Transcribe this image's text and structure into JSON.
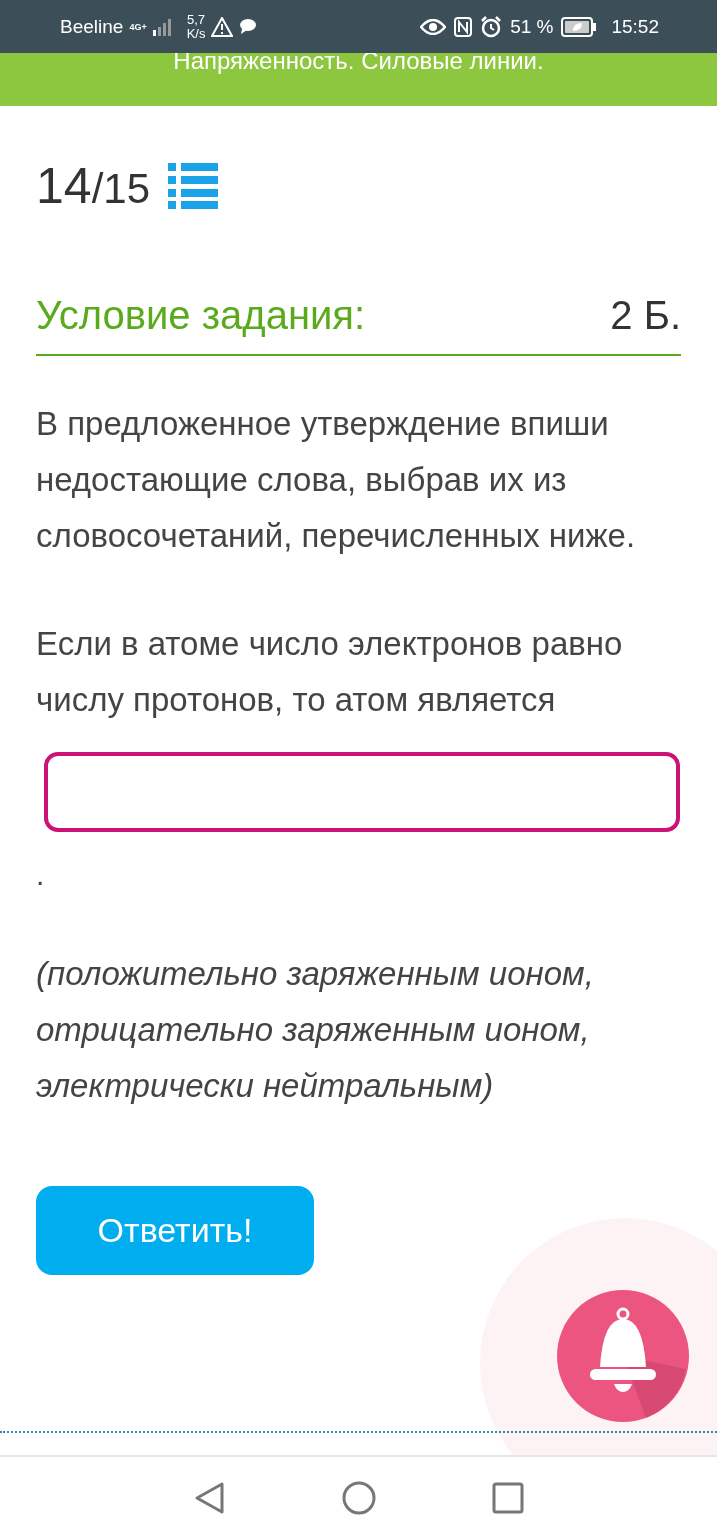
{
  "status_bar": {
    "carrier": "Beeline",
    "network": "4G+",
    "speed_value": "5,7",
    "speed_unit": "K/s",
    "battery": "51 %",
    "time": "15:52"
  },
  "header": {
    "title": "Напряженность. Силовые линии."
  },
  "progress": {
    "current": "14",
    "total": "/15"
  },
  "task": {
    "heading": "Условие задания:",
    "points": "2 Б.",
    "instruction": "В предложенное утверждение впиши недостающие слова, выбрав их из словосочетаний, перечисленных ниже.",
    "statement": "Если в атоме число электронов равно числу протонов, то атом является",
    "after_field": ".",
    "options": "(положительно заряженным ионом, отрицательно заряженным ионом, электрически нейтральным)"
  },
  "answer_button": "Ответить!"
}
